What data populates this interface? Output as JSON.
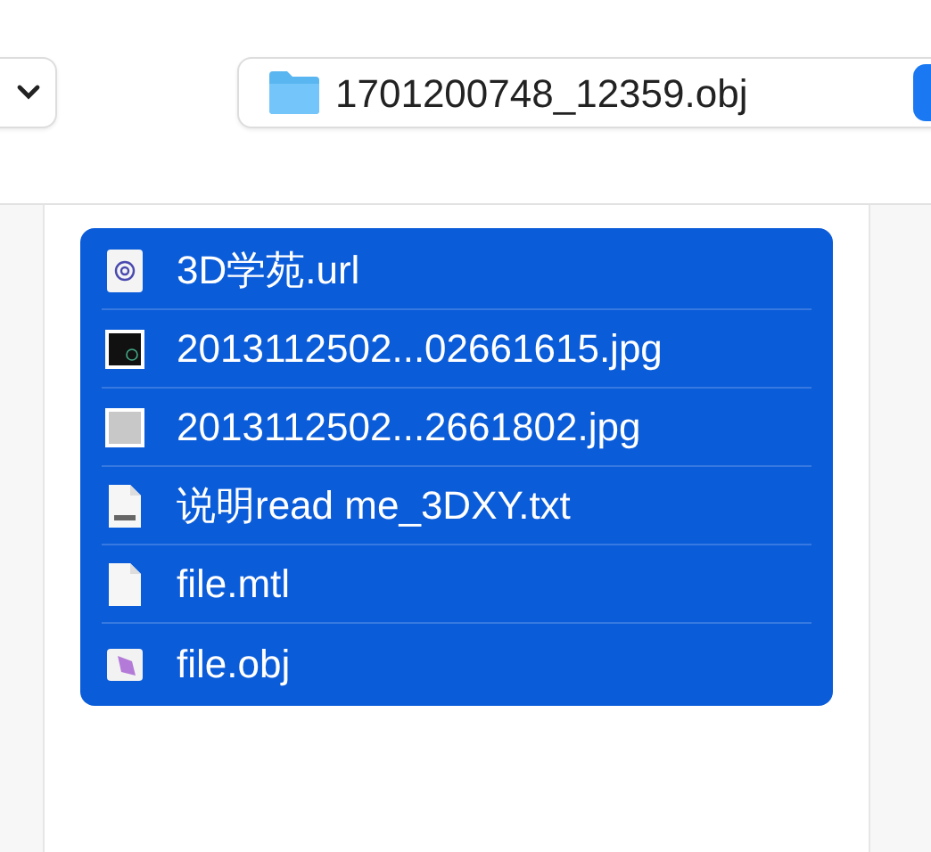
{
  "toolbar": {
    "path_field": {
      "text": "1701200748_12359.obj"
    }
  },
  "files": [
    {
      "name": "3D学苑.url",
      "kind": "url",
      "selected": true
    },
    {
      "name": "2013112502...02661615.jpg",
      "kind": "image-dark",
      "selected": true
    },
    {
      "name": "2013112502...2661802.jpg",
      "kind": "image-light",
      "selected": true
    },
    {
      "name": "说明read me_3DXY.txt",
      "kind": "txt",
      "selected": true
    },
    {
      "name": "file.mtl",
      "kind": "blank",
      "selected": true
    },
    {
      "name": "file.obj",
      "kind": "obj",
      "selected": true
    }
  ]
}
